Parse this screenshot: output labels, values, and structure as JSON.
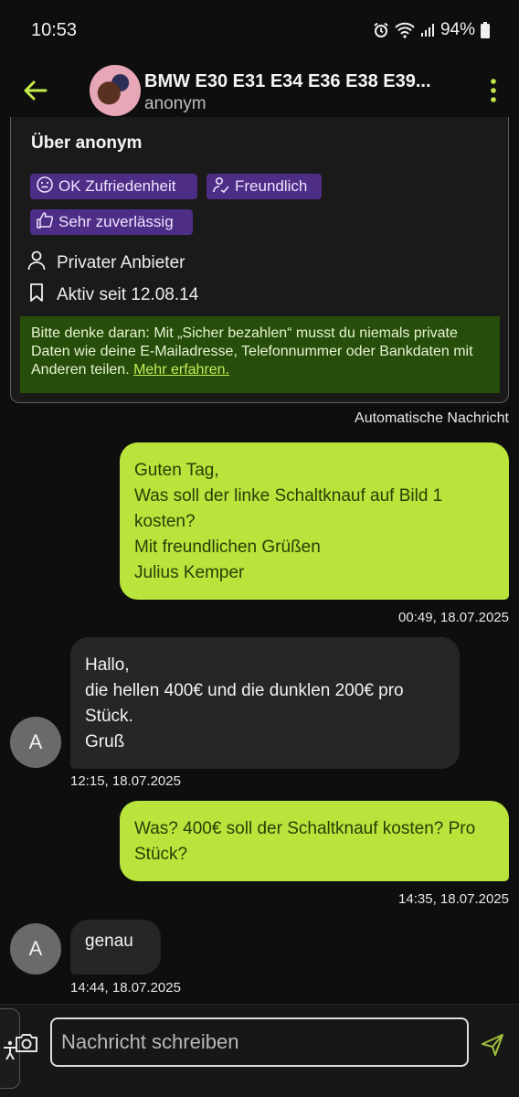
{
  "status": {
    "time": "10:53",
    "battery": "94%"
  },
  "header": {
    "title": "BMW E30 E31 E34 E36 E38 E39...",
    "subtitle": "anonym"
  },
  "about": {
    "heading": "Über anonym",
    "badges": [
      "OK Zufriedenheit",
      "Freundlich",
      "Sehr zuverlässig"
    ],
    "seller_type": "Privater Anbieter",
    "active_since": "Aktiv seit 12.08.14",
    "notice_text": "Bitte denke daran: Mit „Sicher bezahlen“ musst du niemals private Daten wie deine E-Mailadresse, Telefonnummer oder Bankdaten mit Anderen teilen. ",
    "notice_link": "Mehr erfahren."
  },
  "auto_message_label": "Automatische Nachricht",
  "messages": [
    {
      "direction": "out",
      "text": "Guten Tag,\nWas soll der linke Schaltknauf auf Bild 1 kosten?\nMit freundlichen Grüßen\nJulius Kemper",
      "time": "00:49, 18.07.2025"
    },
    {
      "direction": "in",
      "avatar": "A",
      "text": "Hallo,\ndie hellen 400€ und die dunklen 200€ pro Stück.\nGruß",
      "time": "12:15, 18.07.2025"
    },
    {
      "direction": "out",
      "text": "Was? 400€ soll der Schaltknauf kosten? Pro Stück?",
      "time": "14:35, 18.07.2025"
    },
    {
      "direction": "in",
      "avatar": "A",
      "text": "genau",
      "time": "14:44, 18.07.2025"
    }
  ],
  "composer": {
    "placeholder": "Nachricht schreiben"
  },
  "colors": {
    "accent": "#b8e43c",
    "badge": "#4e2d86",
    "notice": "#264d09"
  }
}
